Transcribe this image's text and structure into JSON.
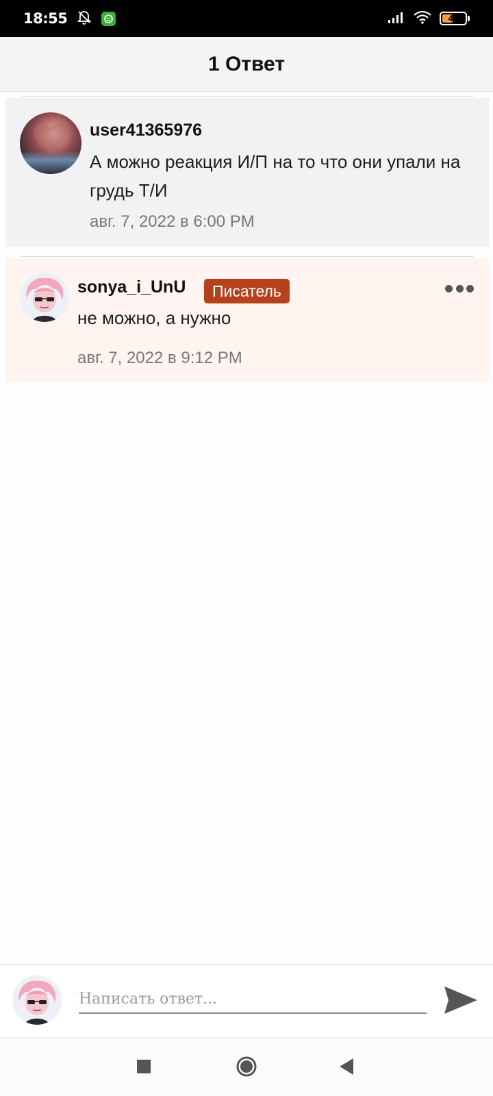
{
  "status_bar": {
    "time": "18:55",
    "battery_level": "47",
    "icons": [
      "mute-bell-icon",
      "app-notification-icon",
      "signal-icon",
      "wifi-icon",
      "battery-icon"
    ]
  },
  "header": {
    "title": "1 Ответ"
  },
  "comments": [
    {
      "username": "user41365976",
      "text": "А можно реакция И/П на то что они упали на грудь Т/И",
      "timestamp": "авг. 7, 2022 в 6:00 PM"
    },
    {
      "username": "sonya_i_UnU",
      "badge": "Писатель",
      "text": "не можно, а нужно",
      "timestamp": "авг. 7, 2022 в 9:12 PM"
    }
  ],
  "composer": {
    "placeholder": "Написать ответ..."
  },
  "nav": {
    "buttons": [
      "recents-square-icon",
      "home-circle-icon",
      "back-triangle-icon"
    ]
  },
  "colors": {
    "badge": "#b5421c",
    "reply_bg": "#fff4f0",
    "comment_bg": "#f2f2f4"
  }
}
